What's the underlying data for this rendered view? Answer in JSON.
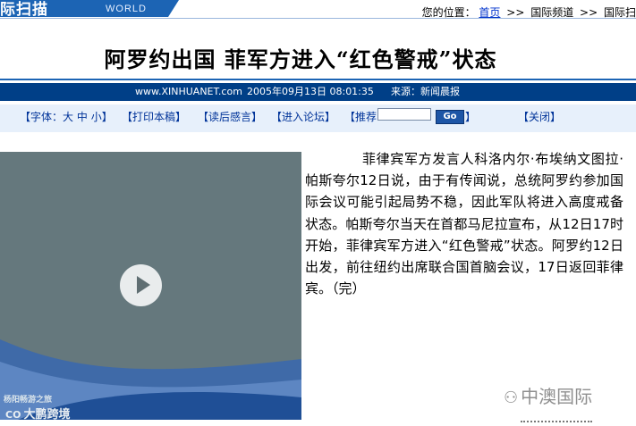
{
  "header": {
    "section_title": "际扫描",
    "section_sub": "WORLD",
    "location_label": "您的位置：",
    "breadcrumbs": [
      "首页",
      "国际频道",
      "国际扫"
    ],
    "crumb_sep": ">>"
  },
  "article": {
    "title": "阿罗约出国  菲军方进入“红色警戒”状态",
    "site": "www.XINHUANET.com",
    "datetime": "2005年09月13日 08:01:35",
    "source": "来源：新闻晨报",
    "body": "菲律宾军方发言人科洛内尔·布埃纳文图拉·帕斯夸尔12日说，由于有传闻说，总统阿罗约参加国际会议可能引起局势不稳，因此军队将进入高度戒备状态。帕斯夸尔当天在首都马尼拉宣布，从12日17时开始，菲律宾军方进入“红色警戒”状态。阿罗约12日出发，前往纽约出席联合国首脑会议，17日返回菲律宾。（完）"
  },
  "toolbar": {
    "font_label": "【字体：",
    "font_large": "大",
    "font_medium": "中",
    "font_small": "小",
    "font_end": "】",
    "print": "【打印本稿】",
    "comment": "【读后感言】",
    "forum": "【进入论坛】",
    "recommend": "【推荐",
    "recommend_end": "】",
    "go": "Go",
    "close": "【关闭】"
  },
  "video": {
    "caption": "杨阳畅游之旅",
    "brand_logo": "CO",
    "brand": "大鹏跨境"
  },
  "watermark": {
    "text": "中澳国际"
  }
}
